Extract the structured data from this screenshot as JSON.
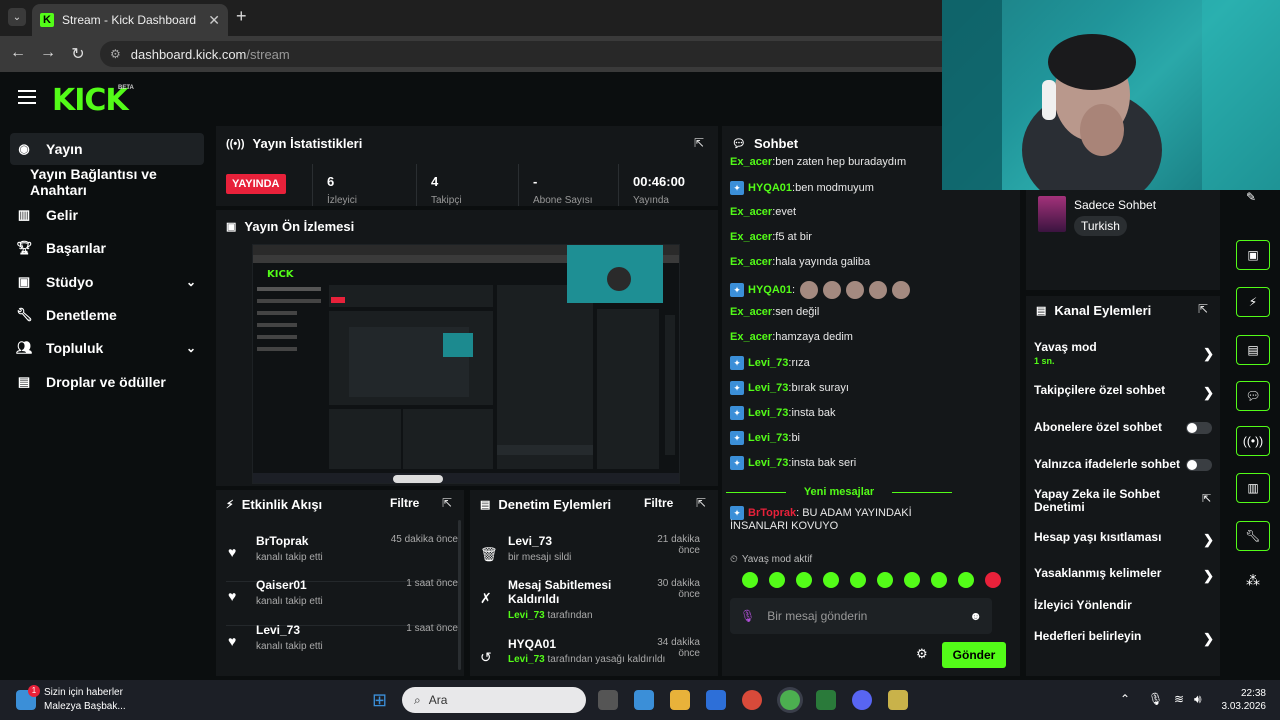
{
  "browser": {
    "tab_title": "Stream - Kick Dashboard",
    "url_domain": "dashboard.kick.com",
    "url_path": "/stream"
  },
  "logo": {
    "text": "KICK",
    "beta": "BETA"
  },
  "sidebar": {
    "items": [
      {
        "label": "Yayın",
        "icon": "stream-icon"
      },
      {
        "label": "Yayın Bağlantısı ve Anahtarı",
        "icon": ""
      },
      {
        "label": "Gelir",
        "icon": "chart-icon"
      },
      {
        "label": "Başarılar",
        "icon": "trophy-icon"
      },
      {
        "label": "Stüdyo",
        "icon": "studio-icon"
      },
      {
        "label": "Denetleme",
        "icon": "wrench-icon"
      },
      {
        "label": "Topluluk",
        "icon": "people-icon"
      },
      {
        "label": "Droplar ve ödüller",
        "icon": "gift-icon"
      }
    ]
  },
  "stats": {
    "title": "Yayın İstatistikleri",
    "live": "YAYINDA",
    "viewers": "6",
    "viewers_label": "İzleyici",
    "followers": "4",
    "followers_label": "Takipçi",
    "subs": "-",
    "subs_label": "Abone Sayısı",
    "uptime": "00:46:00",
    "uptime_label": "Yayında"
  },
  "preview": {
    "title": "Yayın Ön İzlemesi"
  },
  "activity": {
    "title": "Etkinlik Akışı",
    "filter": "Filtre",
    "items": [
      {
        "name": "BrToprak",
        "sub": "kanalı takip etti",
        "time": "45 dakika önce"
      },
      {
        "name": "Qaiser01",
        "sub": "kanalı takip etti",
        "time": "1 saat önce"
      },
      {
        "name": "Levi_73",
        "sub": "kanalı takip etti",
        "time": "1 saat önce"
      }
    ]
  },
  "moderation": {
    "title": "Denetim Eylemleri",
    "filter": "Filtre",
    "items": [
      {
        "name": "Levi_73",
        "sub": "bir mesajı sildi",
        "by": "",
        "time": "21 dakika önce"
      },
      {
        "name": "Mesaj Sabitlemesi Kaldırıldı",
        "by": "Levi_73",
        "sub": "tarafından",
        "time": "30 dakika önce"
      },
      {
        "name": "HYQA01",
        "by": "Levi_73",
        "sub": "tarafından yasağı kaldırıldı",
        "time": "34 dakika önce"
      }
    ]
  },
  "chat": {
    "title": "Sohbet",
    "messages": [
      {
        "user": "Ex_acer",
        "text": "ben zaten hep buradaydım",
        "badge": false
      },
      {
        "user": "HYQA01",
        "text": "ben modmuyum",
        "badge": true
      },
      {
        "user": "Ex_acer",
        "text": "evet",
        "badge": false
      },
      {
        "user": "Ex_acer",
        "text": "f5 at bir",
        "badge": false
      },
      {
        "user": "Ex_acer",
        "text": "hala yayında galiba",
        "badge": false
      },
      {
        "user": "HYQA01",
        "text": "",
        "badge": true,
        "emotes": 5
      },
      {
        "user": "Ex_acer",
        "text": "sen değil",
        "badge": false
      },
      {
        "user": "Ex_acer",
        "text": "hamzaya dedim",
        "badge": false
      },
      {
        "user": "Levi_73",
        "text": "rıza",
        "badge": true
      },
      {
        "user": "Levi_73",
        "text": "bırak surayı",
        "badge": true
      },
      {
        "user": "Levi_73",
        "text": "insta bak",
        "badge": true
      },
      {
        "user": "Levi_73",
        "text": "bi",
        "badge": true
      },
      {
        "user": "Levi_73",
        "text": "insta bak seri",
        "badge": true
      }
    ],
    "new_messages": "Yeni mesajlar",
    "last_user": "BrToprak",
    "last_text": "BU ADAM YAYINDAKİ İNSANLARI KOVUYO",
    "slow_mode": "Yavaş mod aktif",
    "placeholder": "Bir mesaj gönderin",
    "send": "Gönder"
  },
  "chat_settings": {
    "mode": "Sadece Sohbet",
    "language": "Turkish"
  },
  "channel_actions": {
    "title": "Kanal Eylemleri",
    "items": [
      {
        "label": "Yavaş mod",
        "value": "1 sn.",
        "control": "chevron"
      },
      {
        "label": "Takipçilere özel sohbet",
        "value": "",
        "control": "chevron"
      },
      {
        "label": "Abonelere özel sohbet",
        "value": "",
        "control": "toggle"
      },
      {
        "label": "Yalnızca ifadelerle sohbet",
        "value": "",
        "control": "toggle"
      },
      {
        "label": "Yapay Zeka ile Sohbet Denetimi",
        "value": "",
        "control": "external"
      },
      {
        "label": "Hesap yaşı kısıtlaması",
        "value": "",
        "control": "chevron"
      },
      {
        "label": "Yasaklanmış kelimeler",
        "value": "",
        "control": "chevron"
      },
      {
        "label": "İzleyici Yönlendir",
        "value": "",
        "control": "none"
      },
      {
        "label": "Hedefleri belirleyin",
        "value": "",
        "control": "chevron"
      }
    ]
  },
  "taskbar": {
    "news_title": "Sizin için haberler",
    "news_sub": "Malezya Başbak...",
    "news_badge": "1",
    "search": "Ara",
    "time": "22:38",
    "date": "3.03.2026"
  },
  "colors": {
    "accent": "#53fc18",
    "live": "#e8213a",
    "panel": "#141719"
  }
}
